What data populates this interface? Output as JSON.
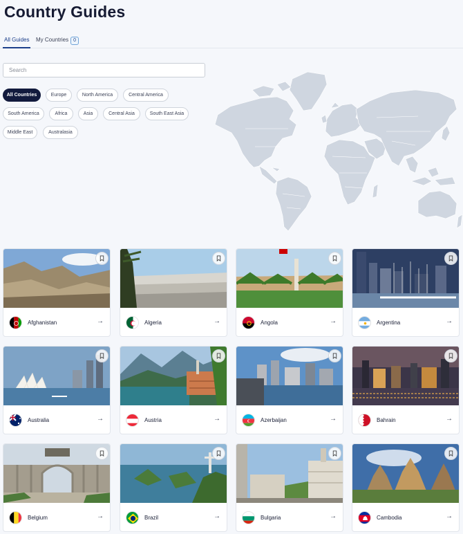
{
  "header": {
    "title": "Country Guides"
  },
  "tabs": [
    {
      "label": "All Guides"
    },
    {
      "label": "My Countries",
      "badge": "0"
    }
  ],
  "search": {
    "placeholder": "Search",
    "value": ""
  },
  "filters": [
    {
      "label": "All Countries",
      "active": true
    },
    {
      "label": "Europe"
    },
    {
      "label": "North America"
    },
    {
      "label": "Central America"
    },
    {
      "label": "South America"
    },
    {
      "label": "Africa"
    },
    {
      "label": "Asia"
    },
    {
      "label": "Central Asia"
    },
    {
      "label": "South East Asia"
    },
    {
      "label": "Middle East"
    },
    {
      "label": "Australasia"
    }
  ],
  "colors": {
    "accent": "#1c3f8a",
    "chip_active": "#121a3d",
    "map_land": "#cfd6e0"
  },
  "countries": [
    {
      "name": "Afghanistan",
      "flag_icon": "afghanistan-flag-icon"
    },
    {
      "name": "Algeria",
      "flag_icon": "algeria-flag-icon"
    },
    {
      "name": "Angola",
      "flag_icon": "angola-flag-icon"
    },
    {
      "name": "Argentina",
      "flag_icon": "argentina-flag-icon"
    },
    {
      "name": "Australia",
      "flag_icon": "australia-flag-icon"
    },
    {
      "name": "Austria",
      "flag_icon": "austria-flag-icon"
    },
    {
      "name": "Azerbaijan",
      "flag_icon": "azerbaijan-flag-icon"
    },
    {
      "name": "Bahrain",
      "flag_icon": "bahrain-flag-icon"
    },
    {
      "name": "Belgium",
      "flag_icon": "belgium-flag-icon"
    },
    {
      "name": "Brazil",
      "flag_icon": "brazil-flag-icon"
    },
    {
      "name": "Bulgaria",
      "flag_icon": "bulgaria-flag-icon"
    },
    {
      "name": "Cambodia",
      "flag_icon": "cambodia-flag-icon"
    }
  ]
}
